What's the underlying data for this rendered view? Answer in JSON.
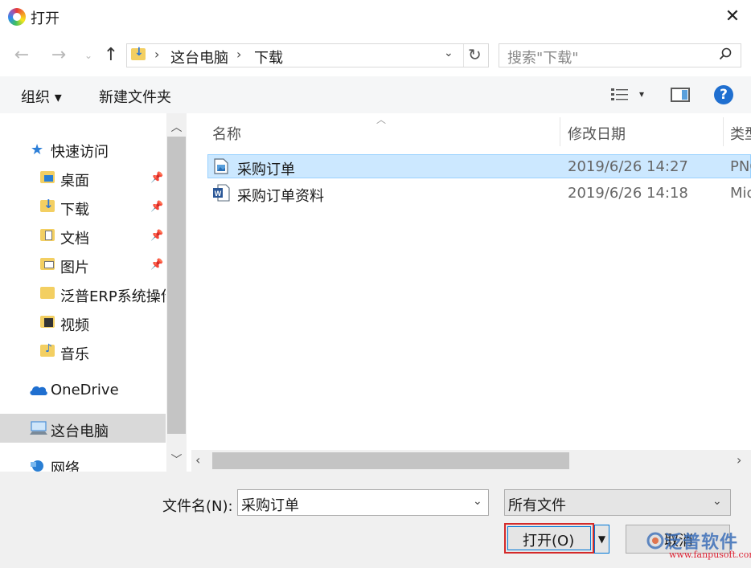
{
  "window": {
    "title": "打开",
    "close_icon": "close-icon"
  },
  "address": {
    "crumbs": [
      "这台电脑",
      "下载"
    ],
    "search_placeholder": "搜索\"下载\""
  },
  "toolbar": {
    "organize": "组织 ▾",
    "new_folder": "新建文件夹"
  },
  "sidebar": {
    "quick_access": "快速访问",
    "items": [
      {
        "label": "桌面",
        "pinned": true
      },
      {
        "label": "下载",
        "pinned": true
      },
      {
        "label": "文档",
        "pinned": true
      },
      {
        "label": "图片",
        "pinned": true
      },
      {
        "label": "泛普ERP系统操作",
        "pinned": false
      },
      {
        "label": "视频",
        "pinned": false
      },
      {
        "label": "音乐",
        "pinned": false
      }
    ],
    "onedrive": "OneDrive",
    "this_pc": "这台电脑",
    "network": "网络"
  },
  "file_list": {
    "columns": [
      "名称",
      "修改日期",
      "类型"
    ],
    "rows": [
      {
        "name": "采购订单",
        "date": "2019/6/26 14:27",
        "type": "PNG",
        "selected": true
      },
      {
        "name": "采购订单资料",
        "date": "2019/6/26 14:18",
        "type": "Micr",
        "selected": false
      }
    ]
  },
  "footer": {
    "filename_label": "文件名(N):",
    "filename_value": "采购订单",
    "filetype_value": "所有文件",
    "open_button": "打开(O)",
    "cancel_button": "取消"
  },
  "watermark": {
    "text": "泛普软件",
    "url": "www.fanpusoft.com"
  },
  "colors": {
    "selection": "#cce8ff",
    "accent": "#0078d7",
    "highlight_border": "#d42a2a"
  }
}
